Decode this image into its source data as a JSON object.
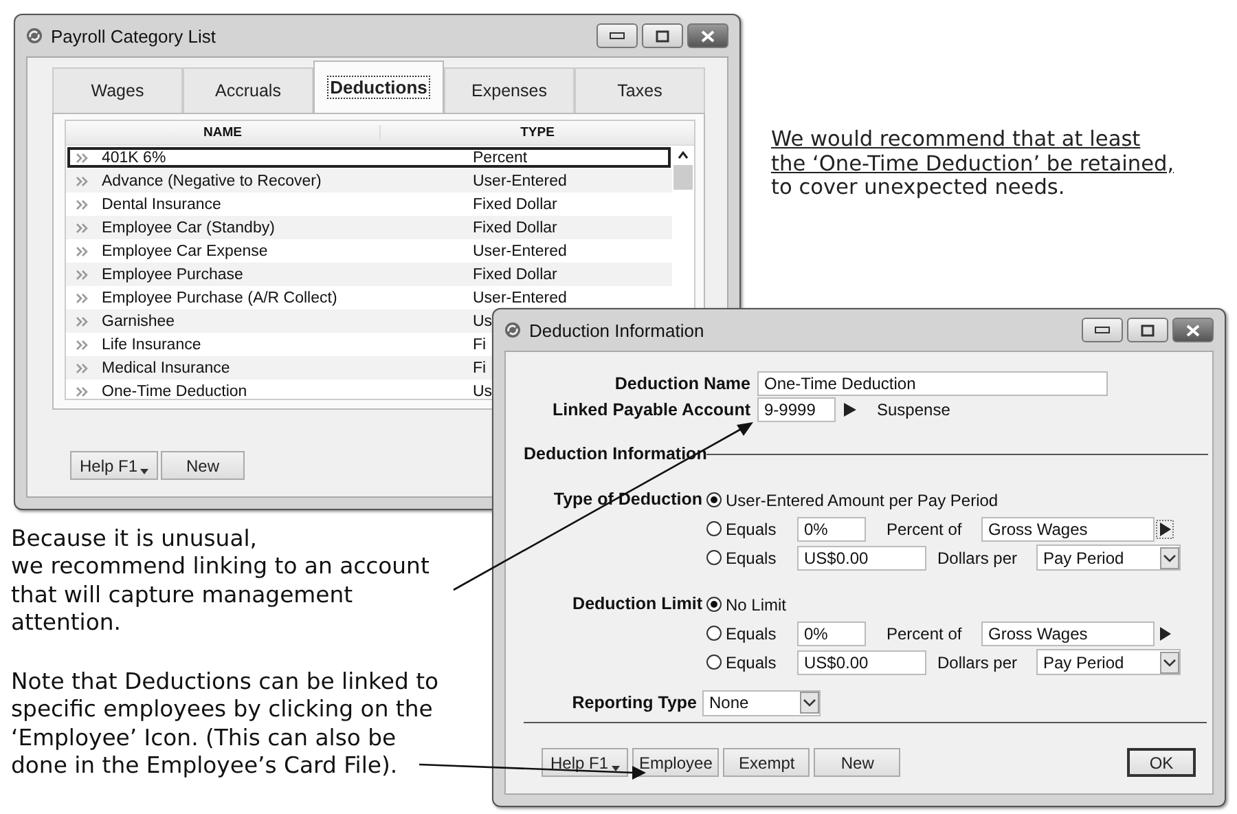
{
  "list_window": {
    "title": "Payroll Category List",
    "tabs": [
      {
        "label": "Wages",
        "selected": false
      },
      {
        "label": "Accruals",
        "selected": false
      },
      {
        "label": "Deductions",
        "selected": true
      },
      {
        "label": "Expenses",
        "selected": false
      },
      {
        "label": "Taxes",
        "selected": false
      }
    ],
    "columns": [
      "NAME",
      "TYPE"
    ],
    "rows": [
      {
        "name": "401K 6%",
        "type": "Percent",
        "selected": true
      },
      {
        "name": "Advance (Negative to Recover)",
        "type": "User-Entered",
        "selected": false
      },
      {
        "name": "Dental Insurance",
        "type": "Fixed Dollar",
        "selected": false
      },
      {
        "name": "Employee Car (Standby)",
        "type": "Fixed Dollar",
        "selected": false
      },
      {
        "name": "Employee Car Expense",
        "type": "User-Entered",
        "selected": false
      },
      {
        "name": "Employee Purchase",
        "type": "Fixed Dollar",
        "selected": false
      },
      {
        "name": "Employee Purchase (A/R Collect)",
        "type": "User-Entered",
        "selected": false
      },
      {
        "name": "Garnishee",
        "type": "Us",
        "selected": false
      },
      {
        "name": "Life Insurance",
        "type": "Fi",
        "selected": false
      },
      {
        "name": "Medical Insurance",
        "type": "Fi",
        "selected": false
      },
      {
        "name": "One-Time Deduction",
        "type": "Us",
        "selected": false
      }
    ],
    "buttons": [
      {
        "label": "Help F1",
        "kind": "menu"
      },
      {
        "label": "New",
        "kind": "plain"
      }
    ]
  },
  "dialog": {
    "title": "Deduction Information",
    "name_label": "Deduction Name",
    "name_value": "One-Time Deduction",
    "account_label": "Linked Payable Account",
    "account_value": "9-9999",
    "account_name": "Suspense",
    "section": "Deduction Information",
    "type_label": "Type of Deduction",
    "type_options": [
      {
        "kind": "plain",
        "label": "User-Entered Amount per Pay Period",
        "selected": true
      },
      {
        "kind": "percent",
        "label": "Equals",
        "value": "0%",
        "unit": "Percent of",
        "basis": "Gross Wages",
        "selected": false
      },
      {
        "kind": "dollars",
        "label": "Equals",
        "value": "US$0.00",
        "unit": "Dollars per",
        "basis": "Pay Period",
        "selected": false
      }
    ],
    "limit_label": "Deduction Limit",
    "limit_options": [
      {
        "kind": "plain",
        "label": "No Limit",
        "selected": true
      },
      {
        "kind": "percent",
        "label": "Equals",
        "value": "0%",
        "unit": "Percent of",
        "basis": "Gross Wages",
        "selected": false
      },
      {
        "kind": "dollars",
        "label": "Equals",
        "value": "US$0.00",
        "unit": "Dollars per",
        "basis": "Pay Period",
        "selected": false
      }
    ],
    "reporting_label": "Reporting Type",
    "reporting_value": "None",
    "buttons": [
      {
        "label": "Help F1",
        "kind": "menu"
      },
      {
        "label": "Employee",
        "kind": "plain"
      },
      {
        "label": "Exempt",
        "kind": "plain"
      },
      {
        "label": "New",
        "kind": "plain"
      }
    ],
    "ok": "OK"
  },
  "recommendation": {
    "underlined": "We would recommend that at least\nthe ‘One-Time Deduction’ be retained,",
    "rest": "to cover unexpected needs."
  },
  "notes": [
    "Because it is unusual,\nwe recommend linking to an account\nthat will capture management\nattention.",
    "Note that Deductions can be linked to\nspecific employees by clicking on the\n‘Employee’ Icon. (This can also be\ndone in the Employee’s Card File)."
  ]
}
